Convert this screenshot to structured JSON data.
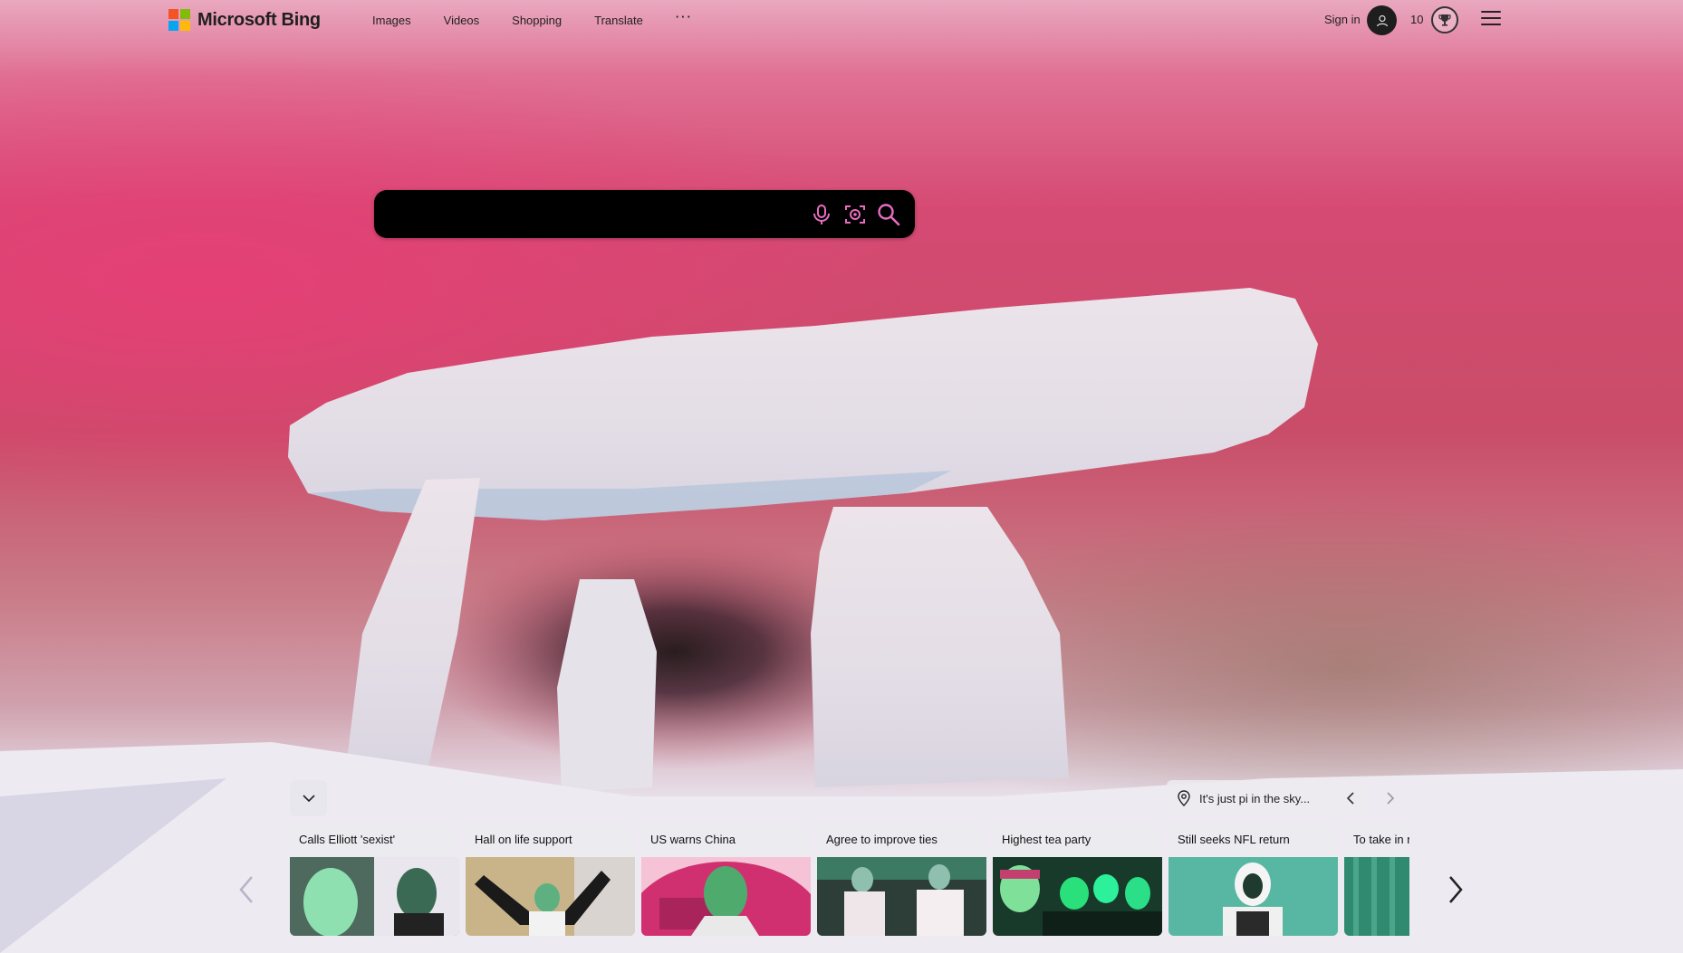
{
  "header": {
    "brand": "Microsoft Bing",
    "nav": [
      "Images",
      "Videos",
      "Shopping",
      "Translate"
    ],
    "more": "···",
    "sign_in": "Sign in",
    "points": "10"
  },
  "search": {
    "placeholder": ""
  },
  "news": {
    "location": "It's just pi in the sky...",
    "cards": [
      {
        "title": "Calls Elliott 'sexist'"
      },
      {
        "title": "Hall on life support"
      },
      {
        "title": "US warns China"
      },
      {
        "title": "Agree to improve ties"
      },
      {
        "title": "Highest tea party"
      },
      {
        "title": "Still seeks NFL return"
      },
      {
        "title": "To take in r"
      }
    ]
  },
  "colors": {
    "logo_red": "#f35325",
    "logo_green": "#81bc06",
    "logo_blue": "#05a6f0",
    "logo_yellow": "#ffba08",
    "search_icon": "#e86cc0"
  }
}
